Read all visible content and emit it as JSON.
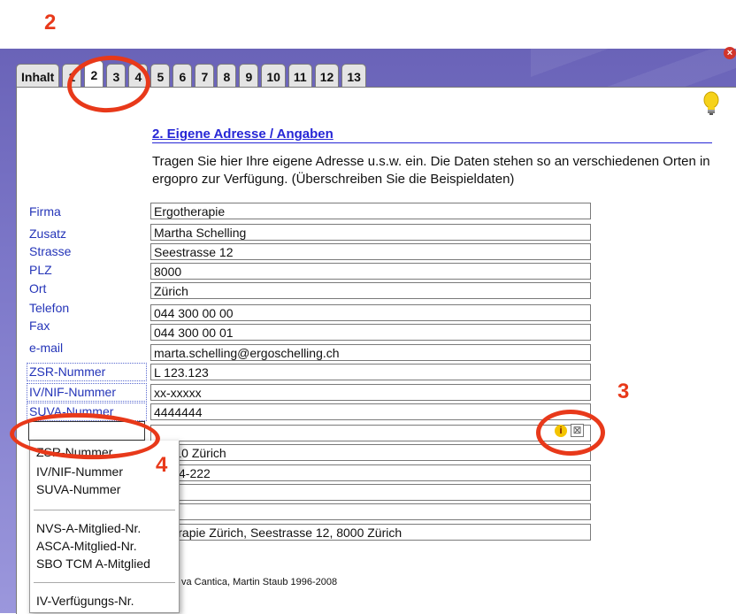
{
  "annotations": {
    "a2": "2",
    "a3": "3",
    "a4": "4"
  },
  "window": {
    "close_glyph": "×"
  },
  "tabs": [
    {
      "label": "Inhalt"
    },
    {
      "label": "1"
    },
    {
      "label": "2",
      "active": true
    },
    {
      "label": "3"
    },
    {
      "label": "4"
    },
    {
      "label": "5"
    },
    {
      "label": "6"
    },
    {
      "label": "7"
    },
    {
      "label": "8"
    },
    {
      "label": "9"
    },
    {
      "label": "10"
    },
    {
      "label": "11"
    },
    {
      "label": "12"
    },
    {
      "label": "13"
    }
  ],
  "section": {
    "heading": "2. Eigene Adresse / Angaben",
    "intro": "Tragen Sie hier Ihre eigene Adresse u.s.w. ein. Die Daten stehen so an verschiedenen Orten in ergopro zur Verfügung. (Überschreiben Sie die Beispieldaten)"
  },
  "labels": {
    "firma": "Firma",
    "zusatz": "Zusatz",
    "strasse": "Strasse",
    "plz": "PLZ",
    "ort": "Ort",
    "telefon": "Telefon",
    "fax": "Fax",
    "email": "e-mail",
    "zsr": "ZSR-Nummer",
    "ivnif": "IV/NIF-Nummer",
    "suva": "SUVA-Nummer"
  },
  "fields": {
    "firma": "Ergotherapie",
    "zusatz": "Martha Schelling",
    "strasse": "Seestrasse 12",
    "plz": "8000",
    "ort": "Zürich",
    "telefon": "044 300 00 00",
    "fax": "044 300 00 01",
    "email": "marta.schelling@ergoschelling.ch",
    "zsr": "L 123.123",
    "ivnif": "xx-xxxxx",
    "suva": "4444444",
    "blank1": "",
    "partial1": ", 8010 Zürich",
    "partial2": "-1234-222",
    "blank2": "",
    "blank3": "",
    "address": "otherapie Zürich, Seestrasse 12, 8000 Zürich"
  },
  "dropdown": {
    "selected_partial": "ZSR-Nummer",
    "group1": [
      "IV/NIF-Nummer",
      "SUVA-Nummer"
    ],
    "group2": [
      "NVS-A-Mitglied-Nr.",
      "ASCA-Mitglied-Nr.",
      "SBO TCM A-Mitglied"
    ],
    "group3": [
      "IV-Verfügungs-Nr."
    ]
  },
  "icons": {
    "info": "i",
    "clear": "⊠",
    "bulb": "lightbulb-icon"
  },
  "footer": {
    "text": "va Cantica, Martin Staub 1996-2008"
  },
  "colors": {
    "annotation": "#e8391a",
    "link_blue": "#2626d6",
    "label_blue": "#2434b8"
  }
}
